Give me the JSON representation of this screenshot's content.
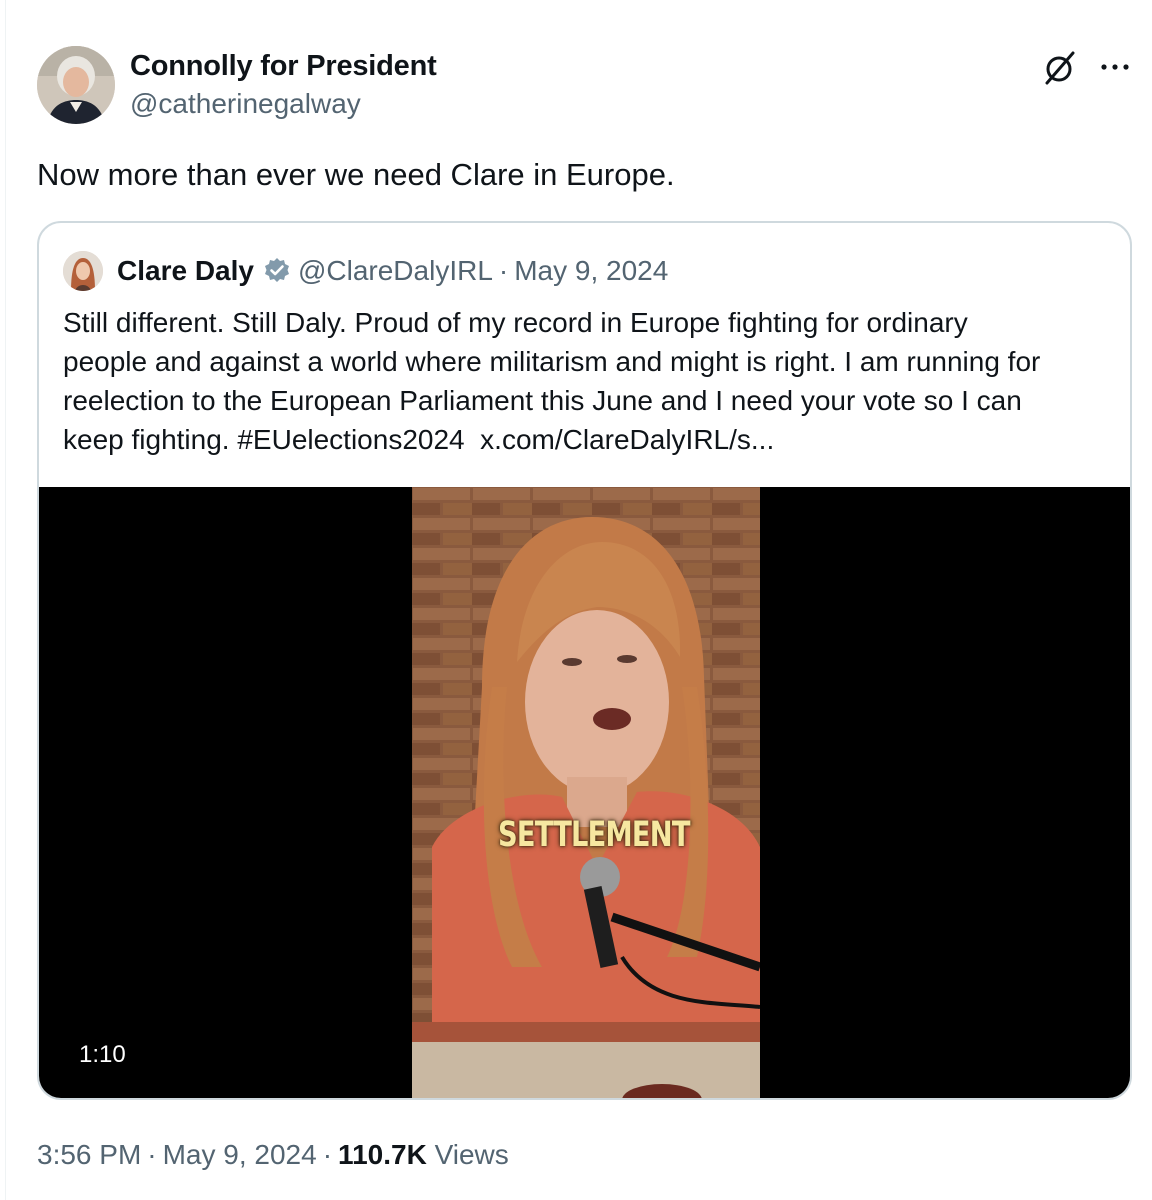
{
  "post": {
    "author": {
      "display_name": "Connolly for President",
      "handle": "@catherinegalway"
    },
    "text": "Now more than ever we need Clare in Europe.",
    "icons": {
      "grok": "grok-icon",
      "more": "more-icon"
    },
    "timestamp": {
      "time": "3:56 PM",
      "separator": "·",
      "date": "May 9, 2024",
      "views_count": "110.7K",
      "views_label": "Views"
    }
  },
  "quoted_post": {
    "author": {
      "display_name": "Clare Daly",
      "handle": "@ClareDalyIRL",
      "separator": "·",
      "date": "May 9, 2024",
      "verified": true
    },
    "text_lines": [
      "Still different. Still Daly. Proud of my record in Europe fighting for ordinary",
      "people and against a world where militarism and might is right. I am running for",
      "reelection to the European Parliament this June and I need your vote so I can",
      "keep fighting. #EUelections2024  x.com/ClareDalyIRL/s..."
    ],
    "video": {
      "caption_overlay": "SETTLEMENT",
      "duration": "1:10"
    }
  },
  "colors": {
    "text_primary": "#0f1419",
    "text_secondary": "#536471",
    "border": "#cfd9de",
    "verified_badge": "#829aab"
  }
}
